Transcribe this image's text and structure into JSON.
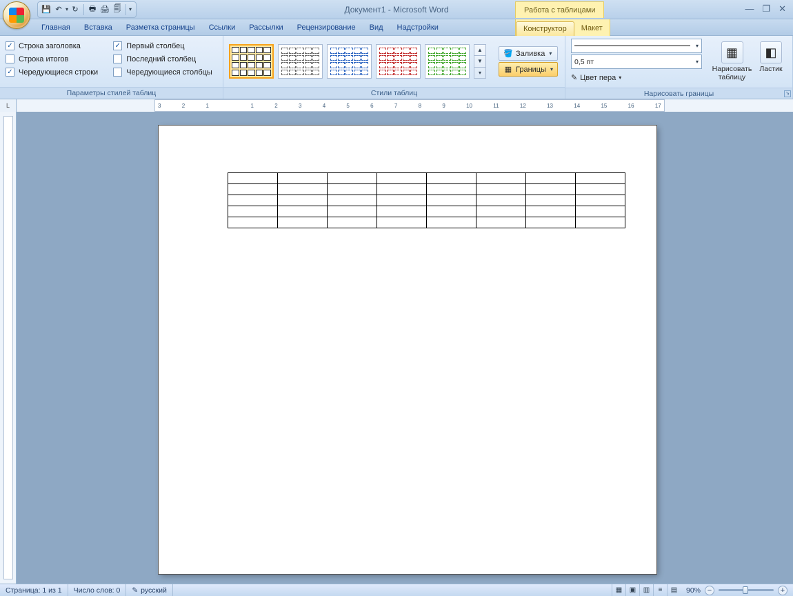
{
  "title": "Документ1 - Microsoft Word",
  "contextual_tab_title": "Работа с таблицами",
  "tabs": {
    "home": "Главная",
    "insert": "Вставка",
    "layout": "Разметка страницы",
    "references": "Ссылки",
    "mailings": "Рассылки",
    "review": "Рецензирование",
    "view": "Вид",
    "addins": "Надстройки",
    "design": "Конструктор",
    "tlayout": "Макет"
  },
  "group1": {
    "label": "Параметры стилей таблиц",
    "header_row": "Строка заголовка",
    "total_row": "Строка итогов",
    "banded_rows": "Чередующиеся строки",
    "first_col": "Первый столбец",
    "last_col": "Последний столбец",
    "banded_cols": "Чередующиеся столбцы"
  },
  "group2": {
    "label": "Стили таблиц",
    "shading": "Заливка",
    "borders": "Границы"
  },
  "group3": {
    "label": "Нарисовать границы",
    "weight": "0,5 пт",
    "pen_color": "Цвет пера",
    "draw": "Нарисовать таблицу",
    "eraser": "Ластик"
  },
  "ruler_numbers": [
    "3",
    "2",
    "1",
    "",
    "1",
    "2",
    "3",
    "4",
    "5",
    "6",
    "7",
    "8",
    "9",
    "10",
    "11",
    "12",
    "13",
    "14",
    "15",
    "16",
    "17"
  ],
  "status": {
    "page": "Страница: 1 из 1",
    "words": "Число слов: 0",
    "lang": "русский",
    "zoom": "90%"
  },
  "doc_table": {
    "rows": 5,
    "cols": 8
  }
}
